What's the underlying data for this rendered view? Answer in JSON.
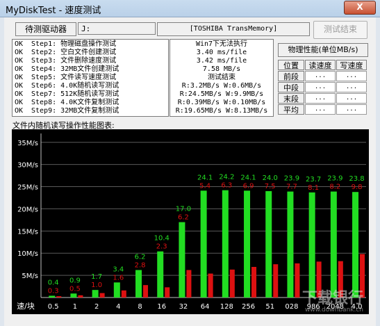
{
  "window": {
    "title": "MyDiskTest - 速度测试",
    "close_label": "X"
  },
  "toolbar": {
    "drive_label": "待测驱动器",
    "drive_letter": "J:",
    "device_name": "[TOSHIBA TransMemory]",
    "end_button": "测试结束"
  },
  "steps": [
    {
      "status": "OK",
      "text": "Step1: 物理磁盘操作测试"
    },
    {
      "status": "OK",
      "text": "Step2: 空白文件创建测试"
    },
    {
      "status": "OK",
      "text": "Step3: 文件删除速度测试"
    },
    {
      "status": "OK",
      "text": "Step4: 32MB文件创建测试"
    },
    {
      "status": "OK",
      "text": "Step5: 文件读写速度测试"
    },
    {
      "status": "OK",
      "text": "Step6: 4.0K随机读写测试"
    },
    {
      "status": "OK",
      "text": "Step7: 512K随机读写测试"
    },
    {
      "status": "OK",
      "text": "Step8: 4.0K文件复制测试"
    },
    {
      "status": "OK",
      "text": "Step9: 32MB文件复制测试"
    }
  ],
  "results": [
    "Win7下无法执行",
    "3.40 ms/file",
    "3.42 ms/file",
    "7.58 MB/s",
    "测试结束",
    "R:3.2MB/s W:0.6MB/s",
    "R:24.5MB/s W:9.9MB/s",
    "R:0.39MB/s W:0.10MB/s",
    "R:19.65MB/s W:8.13MB/s"
  ],
  "perf": {
    "title": "物理性能(单位MB/s)",
    "headers": [
      "位置",
      "读速度",
      "写速度"
    ],
    "rows": [
      {
        "pos": "前段",
        "read": "...",
        "write": "..."
      },
      {
        "pos": "中段",
        "read": "...",
        "write": "..."
      },
      {
        "pos": "末段",
        "read": "...",
        "write": "..."
      },
      {
        "pos": "平均",
        "read": "...",
        "write": "..."
      }
    ]
  },
  "chart_label": "文件内随机读写操作性能图表:",
  "chart_data": {
    "type": "bar",
    "colors": {
      "background": "#000000",
      "read": "#22dd22",
      "write": "#dd1111",
      "grid": "#5a5a5a",
      "label": "#ffffff"
    },
    "ylim": [
      0,
      37
    ],
    "yticks": [
      "5M/s",
      "10M/s",
      "15M/s",
      "20M/s",
      "25M/s",
      "30M/s",
      "35M/s"
    ],
    "ytick_values": [
      5,
      10,
      15,
      20,
      25,
      30,
      35
    ],
    "xlabel": "速/块",
    "categories": [
      "0.5",
      "1",
      "2",
      "4",
      "8",
      "16",
      "32",
      "64",
      "128",
      "256",
      "512",
      "1028",
      "1986",
      "2048",
      "4096"
    ],
    "category_labels": [
      "0.5",
      "1",
      "2",
      "4",
      "8",
      "16",
      "32",
      "64",
      "128",
      "256",
      "51",
      "028",
      "986",
      "2048",
      "4.0"
    ],
    "series": [
      {
        "name": "read",
        "values": [
          0.4,
          0.9,
          1.7,
          3.4,
          6.2,
          10.4,
          17.0,
          24.1,
          24.2,
          24.1,
          24.0,
          23.9,
          23.7,
          23.9,
          23.8
        ]
      },
      {
        "name": "write",
        "values": [
          0.3,
          0.5,
          1.0,
          1.6,
          2.8,
          2.3,
          6.2,
          5.4,
          6.3,
          6.9,
          7.5,
          7.7,
          8.1,
          8.2,
          9.8
        ]
      }
    ],
    "watermark": "下载银行",
    "watermark_url": "www.downbank.cn"
  }
}
